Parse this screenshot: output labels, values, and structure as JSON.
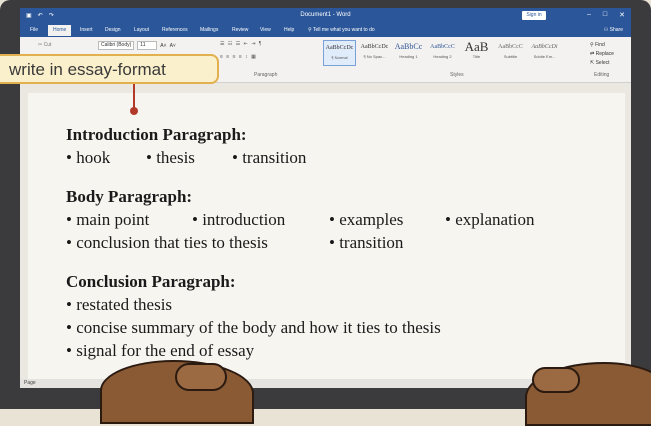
{
  "window": {
    "title": "Document1 - Word",
    "sign_in": "Sign in",
    "minimize": "–",
    "maximize": "□",
    "close": "✕",
    "save_icon": "save-icon",
    "undo_icon": "undo-icon"
  },
  "tabs": [
    {
      "label": "File"
    },
    {
      "label": "Home",
      "active": true
    },
    {
      "label": "Insert"
    },
    {
      "label": "Design"
    },
    {
      "label": "Layout"
    },
    {
      "label": "References"
    },
    {
      "label": "Mailings"
    },
    {
      "label": "Review"
    },
    {
      "label": "View"
    },
    {
      "label": "Help"
    }
  ],
  "tell_me": "Tell me what you want to do",
  "share": "Share",
  "ribbon": {
    "cut": "Cut",
    "font_name": "Calibri (Body)",
    "font_size": "11",
    "paragraph_group": "Paragraph",
    "styles_group": "Styles",
    "editing_group": "Editing",
    "styles": [
      {
        "preview": "AaBbCcDc",
        "name": "¶ Normal",
        "selected": true
      },
      {
        "preview": "AaBbCcDc",
        "name": "¶ No Spac..."
      },
      {
        "preview": "AaBbCc",
        "name": "Heading 1"
      },
      {
        "preview": "AaBbCcC",
        "name": "Heading 2"
      },
      {
        "preview": "AaB",
        "name": "Title",
        "big": true
      },
      {
        "preview": "AaBbCcC",
        "name": "Subtitle"
      },
      {
        "preview": "AaBbCcDi",
        "name": "Subtle Em..."
      }
    ],
    "find": "Find",
    "replace": "Replace",
    "select": "Select"
  },
  "callout": "write in essay-format",
  "document": {
    "intro": {
      "heading": "Introduction Paragraph:",
      "rows": [
        [
          "hook",
          "thesis",
          "transition"
        ]
      ]
    },
    "body": {
      "heading": "Body Paragraph:",
      "rows": [
        [
          "main point",
          "introduction",
          "examples",
          "explanation"
        ],
        [
          "conclusion that ties to thesis",
          "transition"
        ]
      ]
    },
    "conclusion": {
      "heading": "Conclusion Paragraph:",
      "rows": [
        [
          "restated thesis"
        ],
        [
          "concise summary of the body and how it ties to thesis"
        ],
        [
          "signal for the end of essay"
        ]
      ]
    }
  },
  "status": {
    "page": "Page"
  }
}
